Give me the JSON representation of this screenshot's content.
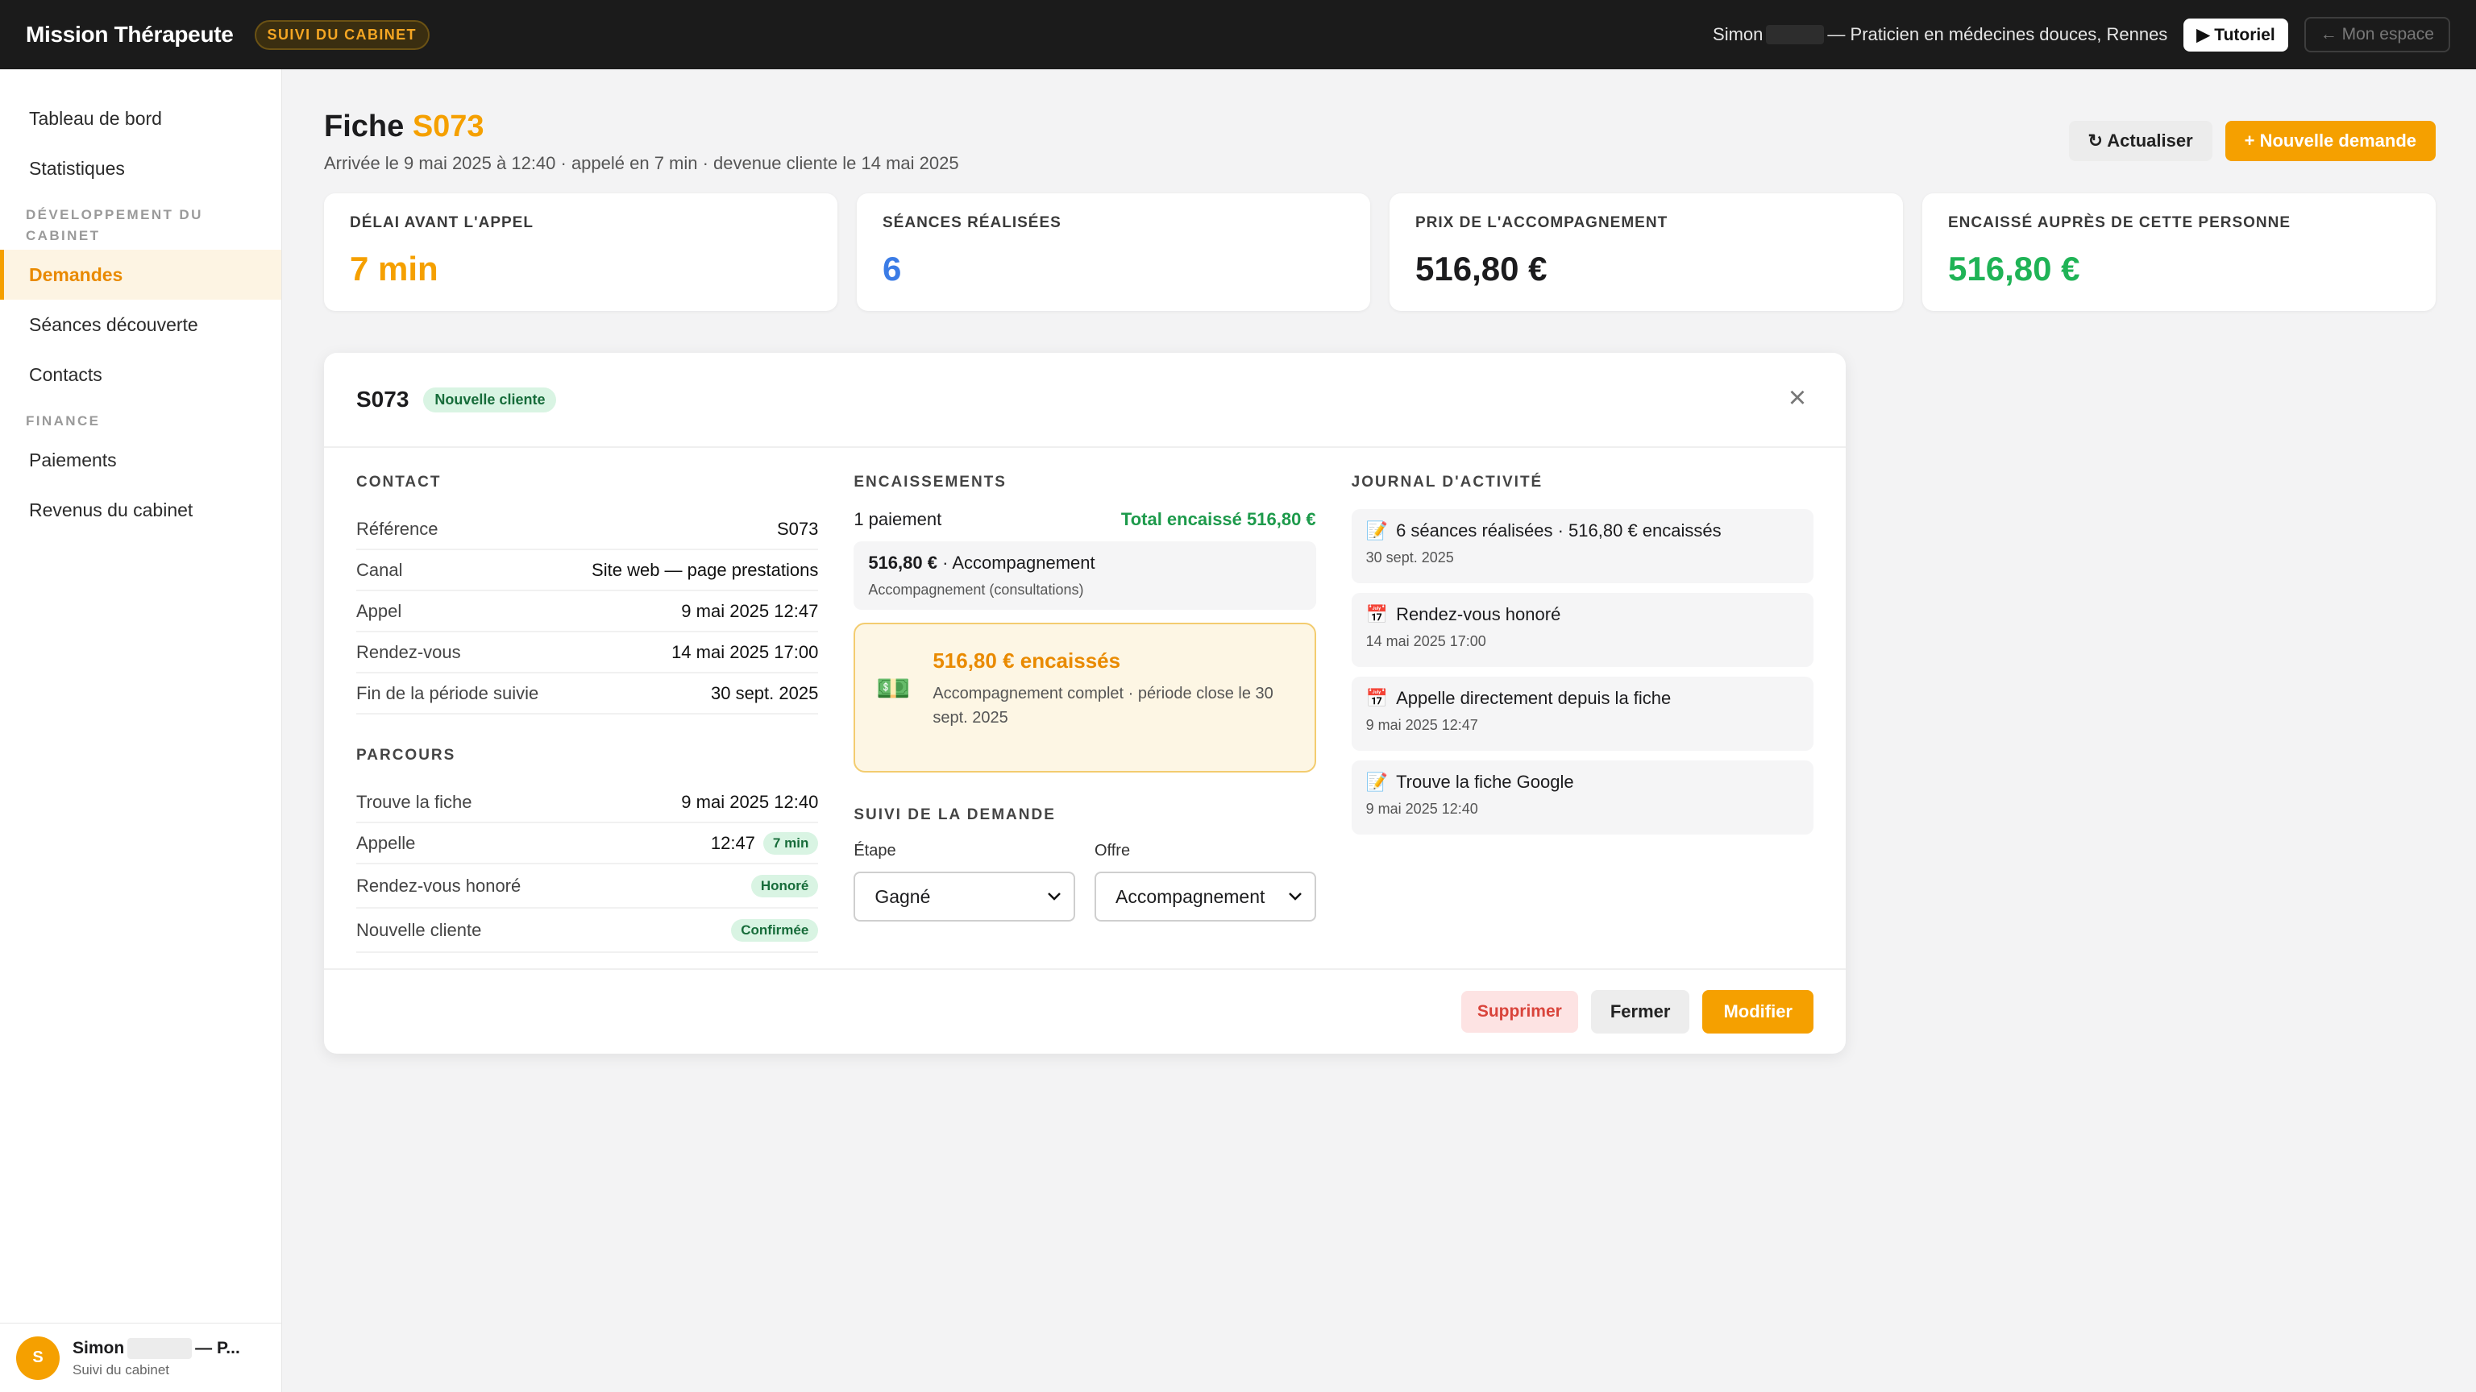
{
  "app": {
    "brand": "Mission Thérapeute",
    "badge": "SUIVI DU CABINET",
    "user_first": "Simon",
    "user_rest": "— Praticien en médecines douces, Rennes",
    "tutorial_label": "▶ Tutoriel",
    "my_space_label": "← Mon espace"
  },
  "sidebar": {
    "items_top": [
      {
        "label": "Tableau de bord"
      },
      {
        "label": "Statistiques"
      }
    ],
    "group1": "DÉVELOPPEMENT DU CABINET",
    "items_dev": [
      {
        "label": "Demandes"
      },
      {
        "label": "Séances découverte"
      },
      {
        "label": "Contacts"
      }
    ],
    "group2": "FINANCE",
    "items_fin": [
      {
        "label": "Paiements"
      },
      {
        "label": "Revenus du cabinet"
      }
    ],
    "footer": {
      "avatar": "S",
      "name_first": "Simon",
      "name_rest": "— P...",
      "sub": "Suivi du cabinet"
    }
  },
  "page": {
    "title_prefix": "Fiche",
    "title_code": "S073",
    "subtitle": "Arrivée le 9 mai 2025 à 12:40 · appelé en 7 min · devenue cliente le 14 mai 2025",
    "refresh_label": "↻ Actualiser",
    "new_label": "+ Nouvelle demande"
  },
  "kpis": [
    {
      "label": "DÉLAI AVANT L'APPEL",
      "value": "7 min",
      "color": "#f5a000"
    },
    {
      "label": "SÉANCES RÉALISÉES",
      "value": "6",
      "color": "#3b7ce6"
    },
    {
      "label": "PRIX DE L'ACCOMPAGNEMENT",
      "value": "516,80 €",
      "color": "#1c1c1e"
    },
    {
      "label": "ENCAISSÉ AUPRÈS DE CETTE PERSONNE",
      "value": "516,80 €",
      "color": "#1fb356"
    }
  ],
  "panel": {
    "title": "S073",
    "status": "Nouvelle cliente",
    "close_icon": "×",
    "contact": {
      "title": "CONTACT",
      "rows": [
        {
          "k": "Référence",
          "v": "S073"
        },
        {
          "k": "Canal",
          "v": "Site web — page prestations"
        },
        {
          "k": "Appel",
          "v": "9 mai 2025 12:47"
        },
        {
          "k": "Rendez-vous",
          "v": "14 mai 2025 17:00"
        },
        {
          "k": "Fin de la période suivie",
          "v": "30 sept. 2025"
        }
      ]
    },
    "parcours": {
      "title": "PARCOURS",
      "rows": [
        {
          "k": "Trouve la fiche",
          "v": "9 mai 2025 12:40",
          "pill": ""
        },
        {
          "k": "Appelle",
          "v": "12:47",
          "pill": "7 min"
        },
        {
          "k": "Rendez-vous honoré",
          "v": "",
          "pill": "Honoré"
        },
        {
          "k": "Nouvelle cliente",
          "v": "",
          "pill": "Confirmée"
        }
      ]
    },
    "encaissements": {
      "title": "ENCAISSEMENTS",
      "count": "1 paiement",
      "total": "Total encaissé 516,80 €",
      "item_amount": "516,80 €",
      "item_label": "· Accompagnement",
      "item_sub": "Accompagnement (consultations)",
      "callout_icon": "💵",
      "callout_title": "516,80 € encaissés",
      "callout_text": "Accompagnement complet · période close le 30 sept. 2025"
    },
    "suivi": {
      "title": "SUIVI DE LA DEMANDE",
      "stage_label": "Étape",
      "stage_value": "Gagné",
      "offer_label": "Offre",
      "offer_value": "Accompagnement"
    },
    "journal": {
      "title": "JOURNAL D'ACTIVITÉ",
      "items": [
        {
          "icon": "📝",
          "text": "6 séances réalisées · 516,80 € encaissés",
          "date": "30 sept. 2025"
        },
        {
          "icon": "📅",
          "text": "Rendez-vous honoré",
          "date": "14 mai 2025 17:00"
        },
        {
          "icon": "📅",
          "text": "Appelle directement depuis la fiche",
          "date": "9 mai 2025 12:47"
        },
        {
          "icon": "📝",
          "text": "Trouve la fiche Google",
          "date": "9 mai 2025 12:40"
        }
      ]
    },
    "footer": {
      "delete": "Supprimer",
      "close": "Fermer",
      "edit": "Modifier"
    }
  }
}
